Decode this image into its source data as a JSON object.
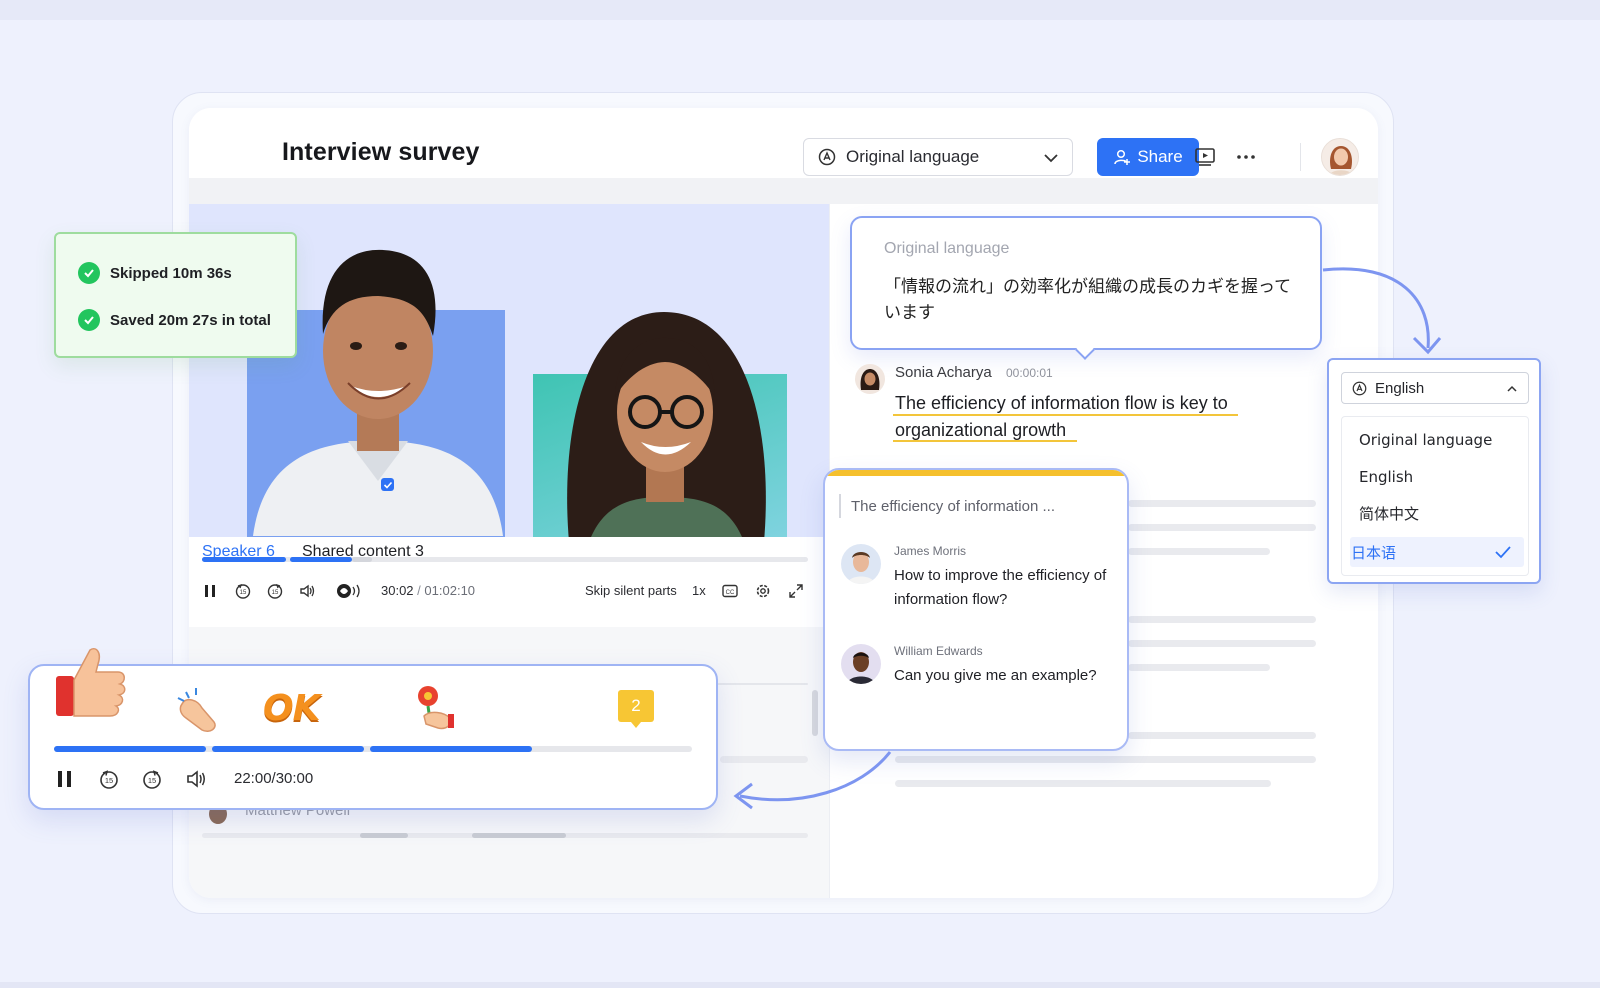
{
  "app": {
    "title": "Interview survey",
    "language_select": "Original language",
    "share_label": "Share"
  },
  "player": {
    "time_current": "30:02",
    "time_separator": "/",
    "time_total": "01:02:10",
    "skip_silent_label": "Skip silent parts",
    "speed": "1x"
  },
  "transcript_tabs": {
    "speaker": "Speaker 6",
    "shared": "Shared content 3"
  },
  "transcript_left": {
    "partial_name": "Matthew Powell"
  },
  "savings": {
    "skipped": "Skipped 10m 36s",
    "saved": "Saved 20m 27s in total"
  },
  "original_bubble": {
    "label": "Original language",
    "text": "「情報の流れ」の効率化が組織の成長のカギを握っています"
  },
  "speaker_line": {
    "name": "Sonia Acharya",
    "time": "00:00:01",
    "quote": "The efficiency of information flow is key to organizational growth"
  },
  "search_card": {
    "query": "The efficiency of information ...",
    "items": [
      {
        "name": "James Morris",
        "text": "How to improve the efficiency of information flow?"
      },
      {
        "name": "William Edwards",
        "text": "Can you give me an example?"
      }
    ]
  },
  "language_dropdown": {
    "selected_label": "English",
    "options": [
      "Original language",
      "English",
      "简体中文",
      "日本语"
    ],
    "checked_option": "日本语"
  },
  "mini_player": {
    "time": "22:00/30:00",
    "ok_label": "OK",
    "comment_count": "2",
    "progress": 0.72
  },
  "colors": {
    "accent": "#2d72f5",
    "highlight": "#f5c02d",
    "success": "#22c55e"
  }
}
